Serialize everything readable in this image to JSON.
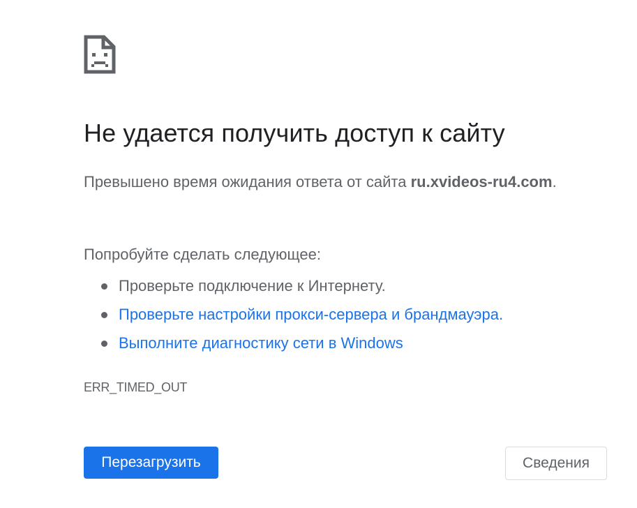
{
  "page": {
    "icon": "sad-page-icon",
    "title": "Не удается получить доступ к сайту",
    "summary_prefix": "Превышено время ожидания ответа от сайта ",
    "summary_host": "ru.xvideos-ru4.com",
    "summary_suffix": ".",
    "suggestions_heading": "Попробуйте сделать следующее:",
    "suggestions": [
      {
        "label": "Проверьте подключение к Интернету.",
        "is_link": false
      },
      {
        "label": "Проверьте настройки прокси-сервера и брандмауэра.",
        "is_link": true
      },
      {
        "label": "Выполните диагностику сети в Windows",
        "is_link": true
      }
    ],
    "error_code": "ERR_TIMED_OUT"
  },
  "buttons": {
    "reload_label": "Перезагрузить",
    "details_label": "Сведения"
  },
  "colors": {
    "primary": "#1a73e8",
    "text_secondary": "#5f6368",
    "title_text": "#202124",
    "border": "#dadce0"
  }
}
